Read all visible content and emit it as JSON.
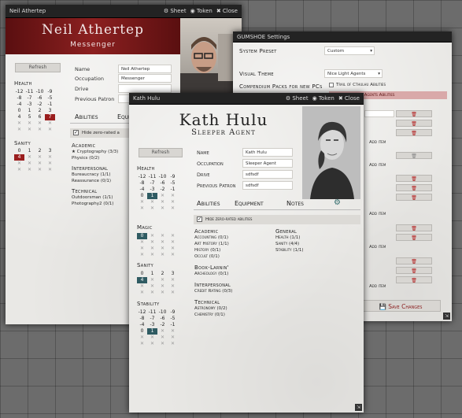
{
  "neil": {
    "title": "Neil Athertep",
    "ctl_sheet": "⚙ Sheet",
    "ctl_token": "◉ Token",
    "ctl_close": "✖ Close",
    "name": "Neil Athertep",
    "occupation": "Messenger",
    "refresh": "Refresh",
    "labels": {
      "name": "Name",
      "occupation": "Occupation",
      "drive": "Drive",
      "patron": "Previous Patron"
    },
    "values": {
      "name": "Neil Athertep",
      "occupation": "Messenger",
      "drive": "",
      "patron": ""
    },
    "health_label": "Health",
    "sanity_label": "Sanity",
    "tabs": {
      "abilities": "Abilities",
      "equipment": "Equip"
    },
    "hide_label": "Hide zero-rated a",
    "sections": [
      {
        "title": "Academic",
        "items": [
          "★ Cryptography (3/3)",
          "Physics (0/2)"
        ]
      },
      {
        "title": "Interpersonal",
        "items": [
          "Bureaucracy (1/1)",
          "Reassurance (0/1)"
        ]
      },
      {
        "title": "Technical",
        "items": [
          "Outdoorsman (1/1)",
          "Photography2 (0/1)"
        ]
      }
    ]
  },
  "settings": {
    "title": "GUMSHOE Settings",
    "system_label": "System Preset",
    "system_value": "Custom",
    "theme_label": "Visual Theme",
    "theme_value": "Nice Light Agents",
    "packs_label": "Compendium Packs for new PCs",
    "pack1": "Trail of Cthulhu Abilities",
    "pack2": "Night's Black Agents Abilities",
    "add_item": "Add item",
    "save": "Save Changes"
  },
  "kath": {
    "title": "Kath Hulu",
    "ctl_sheet": "⚙ Sheet",
    "ctl_token": "◉ Token",
    "ctl_close": "✖ Close",
    "name": "Kath Hulu",
    "occupation": "Sleeper Agent",
    "refresh": "Refresh",
    "labels": {
      "name": "Name",
      "occupation": "Occupation",
      "drive": "Drive",
      "patron": "Previous Patron"
    },
    "values": {
      "name": "Kath Hulu",
      "occupation": "Sleeper Agent",
      "drive": "sdfsdf",
      "patron": "sdfsdf"
    },
    "pools": {
      "health": "Health",
      "magic": "Magic",
      "sanity": "Sanity",
      "stability": "Stability"
    },
    "tabs": {
      "abilities": "Abilities",
      "equipment": "Equipment",
      "notes": "Notes"
    },
    "hide_label": "Hide zero-rated abilities",
    "left_sections": [
      {
        "title": "Academic",
        "items": [
          "Accounting (0/1)",
          "Art History (1/1)",
          "History (0/1)",
          "Occult (0/1)"
        ]
      },
      {
        "title": "Book-Larnin'",
        "items": [
          "Archeology (0/1)"
        ]
      },
      {
        "title": "Interpersonal",
        "items": [
          "Credit Rating (0/3)"
        ]
      },
      {
        "title": "Technical",
        "items": [
          "Astronomy (0/2)",
          "Chemistry (0/1)"
        ]
      }
    ],
    "right_sections": [
      {
        "title": "General",
        "items": [
          "Health (1/1)",
          "Sanity (4/4)",
          "Stability (1/1)"
        ]
      }
    ]
  },
  "colors": {
    "accent_red": "#8a1c1c",
    "teal": "#2f5b62"
  }
}
